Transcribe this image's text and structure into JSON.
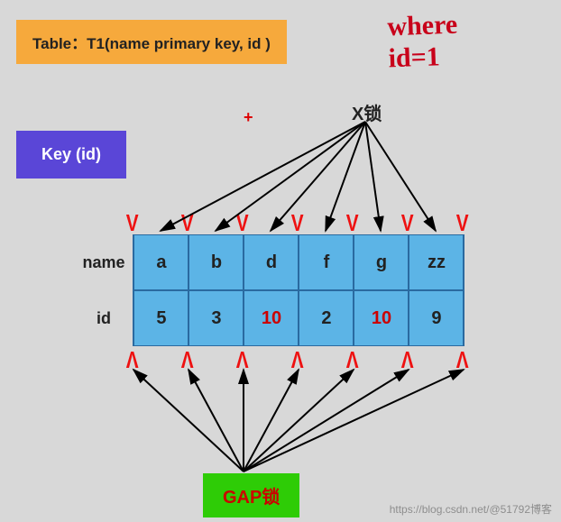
{
  "title": "Table：T1(name  primary  key, id )",
  "key_box": "Key  (id)",
  "plus": "+",
  "xlock": "X锁",
  "gap": "GAP锁",
  "handwriting": "where\nid=1",
  "watermark": "https://blog.csdn.net/@51792博客",
  "table": {
    "row_labels": {
      "name": "name",
      "id": "id"
    },
    "names": [
      "a",
      "b",
      "d",
      "f",
      "g",
      "zz"
    ],
    "ids": [
      "5",
      "3",
      "10",
      "2",
      "10",
      "9"
    ],
    "id_highlight": [
      false,
      false,
      true,
      false,
      true,
      false
    ]
  },
  "chart_data": {
    "type": "table",
    "title": "Table T1(name primary key, id)",
    "columns": [
      "name",
      "id"
    ],
    "rows": [
      {
        "name": "a",
        "id": 5
      },
      {
        "name": "b",
        "id": 3
      },
      {
        "name": "d",
        "id": 10
      },
      {
        "name": "f",
        "id": 2
      },
      {
        "name": "g",
        "id": 10
      },
      {
        "name": "zz",
        "id": 9
      }
    ],
    "x_lock_targets": [
      "a",
      "b",
      "d",
      "f",
      "g",
      "zz"
    ],
    "gap_lock_positions": 7,
    "annotations": [
      "X锁 applied to every record",
      "GAP锁 applied between records"
    ]
  }
}
